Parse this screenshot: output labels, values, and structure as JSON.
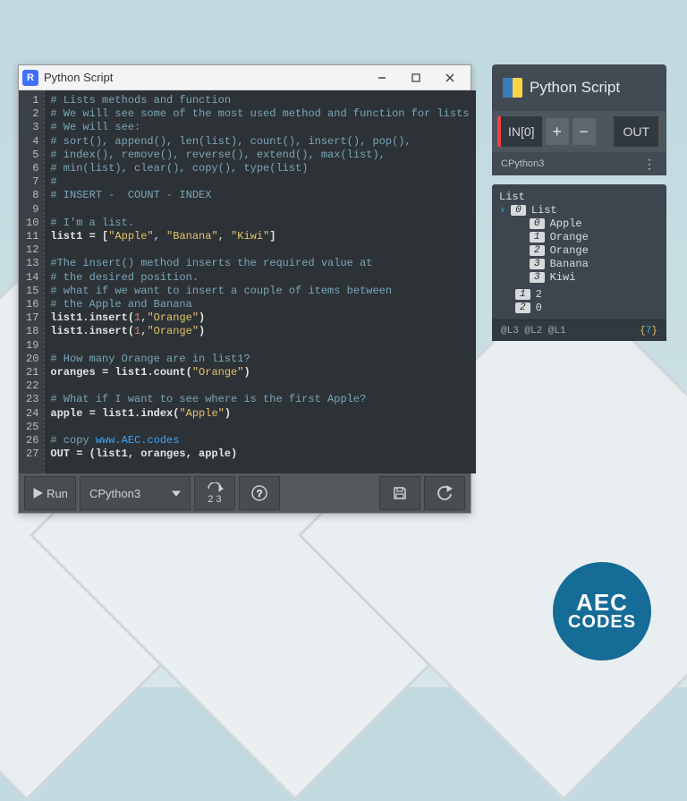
{
  "editor": {
    "title": "Python Script",
    "code_lines": [
      {
        "n": 1,
        "segs": [
          {
            "t": "# Lists methods and function",
            "c": "comment"
          }
        ]
      },
      {
        "n": 2,
        "segs": [
          {
            "t": "# We will see some of the most used method and function for lists",
            "c": "comment"
          }
        ]
      },
      {
        "n": 3,
        "segs": [
          {
            "t": "# We will see:",
            "c": "comment"
          }
        ]
      },
      {
        "n": 4,
        "segs": [
          {
            "t": "# sort(), append(), len(list), count(), insert(), pop(),",
            "c": "comment"
          }
        ]
      },
      {
        "n": 5,
        "segs": [
          {
            "t": "# index(), remove(), reverse(), extend(), max(list),",
            "c": "comment"
          }
        ]
      },
      {
        "n": 6,
        "segs": [
          {
            "t": "# min(list), clear(), copy(), type(list)",
            "c": "comment"
          }
        ]
      },
      {
        "n": 7,
        "segs": [
          {
            "t": "#",
            "c": "comment"
          }
        ]
      },
      {
        "n": 8,
        "segs": [
          {
            "t": "# INSERT -  COUNT - INDEX",
            "c": "comment"
          }
        ]
      },
      {
        "n": 9,
        "segs": [
          {
            "t": "",
            "c": "plain"
          }
        ]
      },
      {
        "n": 10,
        "segs": [
          {
            "t": "# I'm a list.",
            "c": "comment"
          }
        ]
      },
      {
        "n": 11,
        "segs": [
          {
            "t": "list1 = [",
            "c": "kw"
          },
          {
            "t": "\"Apple\"",
            "c": "str"
          },
          {
            "t": ", ",
            "c": "plain"
          },
          {
            "t": "\"Banana\"",
            "c": "str"
          },
          {
            "t": ", ",
            "c": "plain"
          },
          {
            "t": "\"Kiwi\"",
            "c": "str"
          },
          {
            "t": "]",
            "c": "kw"
          }
        ]
      },
      {
        "n": 12,
        "segs": [
          {
            "t": "",
            "c": "plain"
          }
        ]
      },
      {
        "n": 13,
        "segs": [
          {
            "t": "#The insert() method inserts the required value at",
            "c": "comment"
          }
        ]
      },
      {
        "n": 14,
        "segs": [
          {
            "t": "# the desired position.",
            "c": "comment"
          }
        ]
      },
      {
        "n": 15,
        "segs": [
          {
            "t": "# what if we want to insert a couple of items between",
            "c": "comment"
          }
        ]
      },
      {
        "n": 16,
        "segs": [
          {
            "t": "# the Apple and Banana",
            "c": "comment"
          }
        ]
      },
      {
        "n": 17,
        "segs": [
          {
            "t": "list1.insert(",
            "c": "kw"
          },
          {
            "t": "1",
            "c": "num"
          },
          {
            "t": ",",
            "c": "plain"
          },
          {
            "t": "\"Orange\"",
            "c": "str"
          },
          {
            "t": ")",
            "c": "kw"
          }
        ]
      },
      {
        "n": 18,
        "segs": [
          {
            "t": "list1.insert(",
            "c": "kw"
          },
          {
            "t": "1",
            "c": "num"
          },
          {
            "t": ",",
            "c": "plain"
          },
          {
            "t": "\"Orange\"",
            "c": "str"
          },
          {
            "t": ")",
            "c": "kw"
          }
        ]
      },
      {
        "n": 19,
        "segs": [
          {
            "t": "",
            "c": "plain"
          }
        ]
      },
      {
        "n": 20,
        "segs": [
          {
            "t": "# How many Orange are in list1?",
            "c": "comment"
          }
        ]
      },
      {
        "n": 21,
        "segs": [
          {
            "t": "oranges = list1.count(",
            "c": "kw"
          },
          {
            "t": "\"Orange\"",
            "c": "str"
          },
          {
            "t": ")",
            "c": "kw"
          }
        ]
      },
      {
        "n": 22,
        "segs": [
          {
            "t": "",
            "c": "plain"
          }
        ]
      },
      {
        "n": 23,
        "segs": [
          {
            "t": "# What if I want to see where is the first Apple?",
            "c": "comment"
          }
        ]
      },
      {
        "n": 24,
        "segs": [
          {
            "t": "apple = list1.index(",
            "c": "kw"
          },
          {
            "t": "\"Apple\"",
            "c": "str"
          },
          {
            "t": ")",
            "c": "kw"
          }
        ]
      },
      {
        "n": 25,
        "segs": [
          {
            "t": "",
            "c": "plain"
          }
        ]
      },
      {
        "n": 26,
        "segs": [
          {
            "t": "# copy ",
            "c": "comment"
          },
          {
            "t": "www.AEC.codes",
            "c": "link"
          }
        ]
      },
      {
        "n": 27,
        "segs": [
          {
            "t": "OUT = (list1, oranges, apple)",
            "c": "kw"
          }
        ]
      }
    ],
    "toolbar": {
      "run_label": "Run",
      "interpreter": "CPython3",
      "reset_label": "2 3"
    }
  },
  "node": {
    "title": "Python Script",
    "port_in_label": "IN[0]",
    "plus_label": "+",
    "minus_label": "−",
    "port_out_label": "OUT",
    "engine_label": "CPython3",
    "output_header": "List",
    "output_root": {
      "idx": "0",
      "label": "List"
    },
    "output_items": [
      {
        "idx": "0",
        "label": "Apple"
      },
      {
        "idx": "1",
        "label": "Orange"
      },
      {
        "idx": "2",
        "label": "Orange"
      },
      {
        "idx": "3",
        "label": "Banana"
      },
      {
        "idx": "3",
        "label": "Kiwi"
      }
    ],
    "output_tail": [
      {
        "idx": "1",
        "label": "2"
      },
      {
        "idx": "2",
        "label": "0"
      }
    ],
    "footer_levels": "@L3 @L2 @L1",
    "footer_count": "7"
  },
  "branding": {
    "line1": "AEC",
    "line2": "CODES"
  }
}
